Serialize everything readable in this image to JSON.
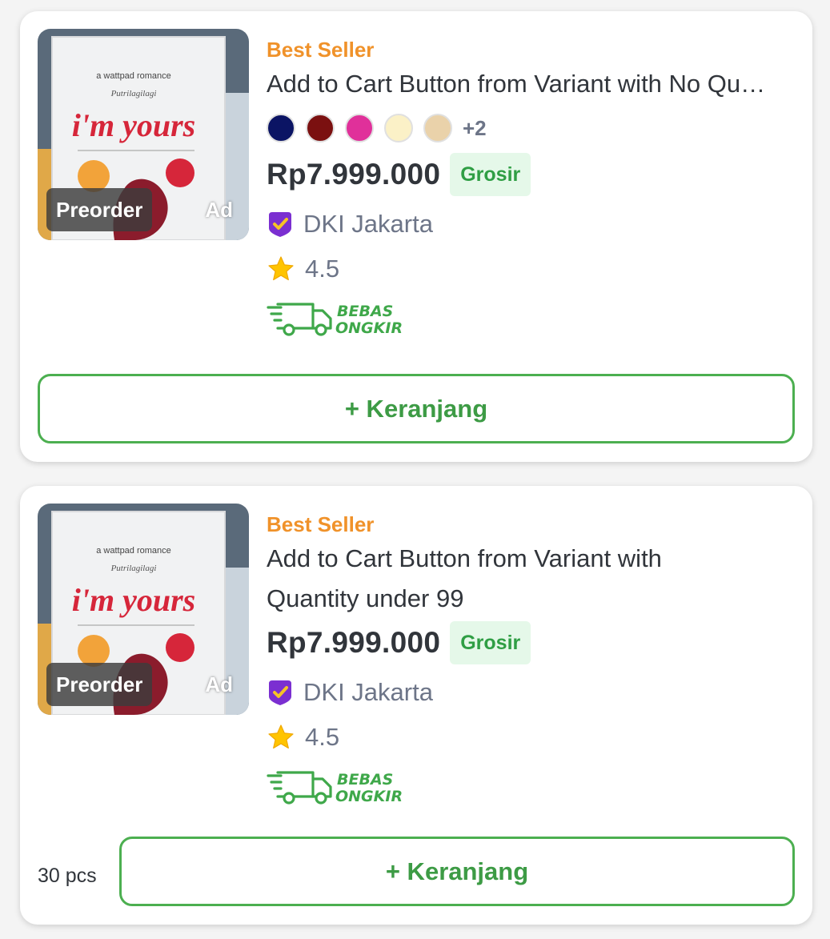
{
  "colors": {
    "accent_green": "#4caf50",
    "best_seller_orange": "#f0922a",
    "grosir_bg": "#e5f8e9"
  },
  "products": [
    {
      "thumbnail": {
        "icon": "book-cover-image",
        "badge_preorder": "Preorder",
        "badge_ad": "Ad",
        "cover_text": {
          "series": "a wattpad romance",
          "author": "Putrilagilagi",
          "title": "i'm yours"
        }
      },
      "label": "Best Seller",
      "title": "Add to Cart Button from Variant with No Qu…",
      "swatches": [
        "#0b1464",
        "#7b1010",
        "#e0309a",
        "#fbf1c7",
        "#ead2aa"
      ],
      "more_swatches": "+2",
      "price": "Rp7.999.000",
      "grosir": "Grosir",
      "location": "DKI Jakarta",
      "rating": "4.5",
      "free_shipping": {
        "line1": "BEBAS",
        "line2": "ONGKIR"
      },
      "cart_button": "+ Keranjang"
    },
    {
      "thumbnail": {
        "icon": "book-cover-image",
        "badge_preorder": "Preorder",
        "badge_ad": "Ad",
        "cover_text": {
          "series": "a wattpad romance",
          "author": "Putrilagilagi",
          "title": "i'm yours"
        }
      },
      "label": "Best Seller",
      "title_line1": "Add to Cart Button from Variant with",
      "title_line2": "Quantity under 99",
      "price": "Rp7.999.000",
      "grosir": "Grosir",
      "location": "DKI Jakarta",
      "rating": "4.5",
      "free_shipping": {
        "line1": "BEBAS",
        "line2": "ONGKIR"
      },
      "quantity_label": "30 pcs",
      "cart_button": "+ Keranjang"
    }
  ]
}
